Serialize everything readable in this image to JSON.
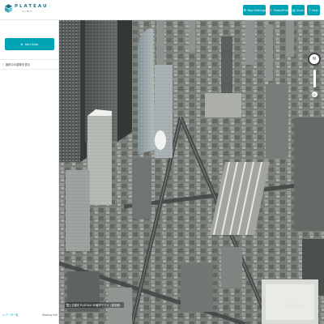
{
  "header": {
    "brand": "PLATEAU",
    "brand_sub": "by MLIT",
    "buttons": [
      {
        "label": "Map Settings",
        "icon": "gear-icon"
      },
      {
        "label": "Share/Print",
        "icon": "share-icon"
      },
      {
        "label": "Story",
        "icon": "book-icon"
      },
      {
        "label": "Help",
        "icon": "help-icon"
      }
    ]
  },
  "sidebar": {
    "add_button": "Add Data",
    "layer_label": "選択中の建物を表示",
    "footer_left": "データ一覧",
    "footer_right": "Sharing link"
  },
  "map": {
    "attribution": "国土交通省 PLATEAU 3D都市モデル（東京都）",
    "engine_label": "CESIUM ion"
  },
  "colors": {
    "accent": "#00a4b4"
  }
}
